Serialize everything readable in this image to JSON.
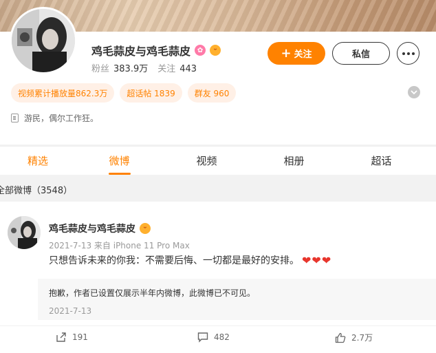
{
  "profile": {
    "name": "鸡毛蒜皮与鸡毛蒜皮",
    "fans_label": "粉丝",
    "fans_value": "383.9万",
    "following_label": "关注",
    "following_value": "443",
    "follow_button": "关注",
    "message_button": "私信",
    "chips": [
      "视频累计播放量862.3万",
      "超话帖 1839",
      "群友 960"
    ],
    "bio": "游民，偶尔工作狂。"
  },
  "tabs": [
    "精选",
    "微博",
    "视频",
    "相册",
    "超话"
  ],
  "active_tab": "微博",
  "feed": {
    "header": "全部微博（3548）",
    "post": {
      "author": "鸡毛蒜皮与鸡毛蒜皮",
      "meta": "2021-7-13 来自 iPhone 11 Pro Max",
      "text": "只想告诉未来的你我：不需要后悔、一切都是最好的安排。",
      "hearts": "❤❤❤",
      "notice": "抱歉，作者已设置仅展示半年内微博，此微博已不可见。",
      "notice_date": "2021-7-13",
      "reposts": "191",
      "comments": "482",
      "likes": "2.7万"
    }
  },
  "colors": {
    "accent": "#ff8200",
    "chip_bg": "#fff0e6",
    "heart": "#e8362d"
  }
}
